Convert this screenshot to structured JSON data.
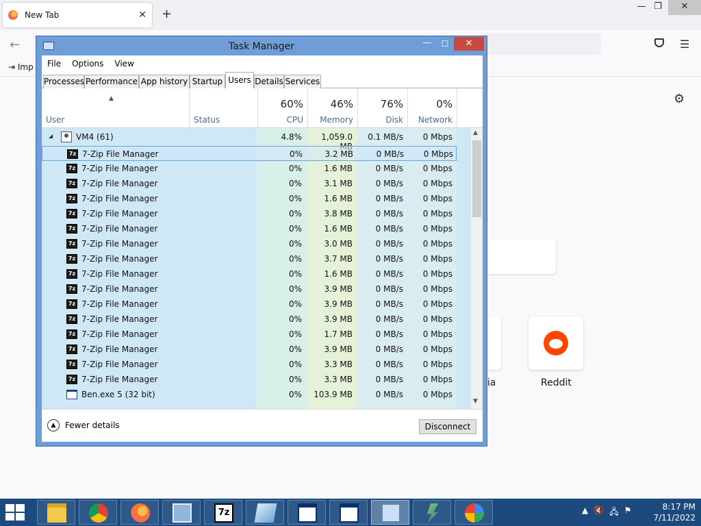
{
  "firefox": {
    "tab_title": "New Tab",
    "tab_close": "✕",
    "new_tab": "+",
    "import_label": "Imp",
    "partial_tile_label": "lia",
    "tile_label": "Reddit",
    "win_min": "—",
    "win_max": "❐",
    "win_close": "✕"
  },
  "task_manager": {
    "title": "Task Manager",
    "controls": {
      "minimize": "—",
      "maximize": "☐",
      "close": "✕"
    },
    "menu": [
      "File",
      "Options",
      "View"
    ],
    "tabs": [
      "Processes",
      "Performance",
      "App history",
      "Startup",
      "Users",
      "Details",
      "Services"
    ],
    "active_tab": "Users",
    "columns": {
      "user": "User",
      "status": "Status",
      "cpu": {
        "pct": "60%",
        "name": "CPU"
      },
      "memory": {
        "pct": "46%",
        "name": "Memory"
      },
      "disk": {
        "pct": "76%",
        "name": "Disk"
      },
      "network": {
        "pct": "0%",
        "name": "Network"
      }
    },
    "group": {
      "name": "VM4 (61)",
      "cpu": "4.8%",
      "memory": "1,059.0 MB",
      "disk": "0.1 MB/s",
      "network": "0 Mbps"
    },
    "rows": [
      {
        "name": "7-Zip File Manager",
        "icon": "7zip-icon",
        "cpu": "0%",
        "memory": "3.2 MB",
        "disk": "0 MB/s",
        "network": "0 Mbps"
      },
      {
        "name": "7-Zip File Manager",
        "icon": "7zip-icon",
        "cpu": "0%",
        "memory": "1.6 MB",
        "disk": "0 MB/s",
        "network": "0 Mbps"
      },
      {
        "name": "7-Zip File Manager",
        "icon": "7zip-icon",
        "cpu": "0%",
        "memory": "3.1 MB",
        "disk": "0 MB/s",
        "network": "0 Mbps"
      },
      {
        "name": "7-Zip File Manager",
        "icon": "7zip-icon",
        "cpu": "0%",
        "memory": "1.6 MB",
        "disk": "0 MB/s",
        "network": "0 Mbps"
      },
      {
        "name": "7-Zip File Manager",
        "icon": "7zip-icon",
        "cpu": "0%",
        "memory": "3.8 MB",
        "disk": "0 MB/s",
        "network": "0 Mbps"
      },
      {
        "name": "7-Zip File Manager",
        "icon": "7zip-icon",
        "cpu": "0%",
        "memory": "1.6 MB",
        "disk": "0 MB/s",
        "network": "0 Mbps"
      },
      {
        "name": "7-Zip File Manager",
        "icon": "7zip-icon",
        "cpu": "0%",
        "memory": "3.0 MB",
        "disk": "0 MB/s",
        "network": "0 Mbps"
      },
      {
        "name": "7-Zip File Manager",
        "icon": "7zip-icon",
        "cpu": "0%",
        "memory": "3.7 MB",
        "disk": "0 MB/s",
        "network": "0 Mbps"
      },
      {
        "name": "7-Zip File Manager",
        "icon": "7zip-icon",
        "cpu": "0%",
        "memory": "1.6 MB",
        "disk": "0 MB/s",
        "network": "0 Mbps"
      },
      {
        "name": "7-Zip File Manager",
        "icon": "7zip-icon",
        "cpu": "0%",
        "memory": "3.9 MB",
        "disk": "0 MB/s",
        "network": "0 Mbps"
      },
      {
        "name": "7-Zip File Manager",
        "icon": "7zip-icon",
        "cpu": "0%",
        "memory": "3.9 MB",
        "disk": "0 MB/s",
        "network": "0 Mbps"
      },
      {
        "name": "7-Zip File Manager",
        "icon": "7zip-icon",
        "cpu": "0%",
        "memory": "3.9 MB",
        "disk": "0 MB/s",
        "network": "0 Mbps"
      },
      {
        "name": "7-Zip File Manager",
        "icon": "7zip-icon",
        "cpu": "0%",
        "memory": "1.7 MB",
        "disk": "0 MB/s",
        "network": "0 Mbps"
      },
      {
        "name": "7-Zip File Manager",
        "icon": "7zip-icon",
        "cpu": "0%",
        "memory": "3.9 MB",
        "disk": "0 MB/s",
        "network": "0 Mbps"
      },
      {
        "name": "7-Zip File Manager",
        "icon": "7zip-icon",
        "cpu": "0%",
        "memory": "3.3 MB",
        "disk": "0 MB/s",
        "network": "0 Mbps"
      },
      {
        "name": "7-Zip File Manager",
        "icon": "7zip-icon",
        "cpu": "0%",
        "memory": "3.3 MB",
        "disk": "0 MB/s",
        "network": "0 Mbps"
      },
      {
        "name": "Ben.exe 5 (32 bit)",
        "icon": "window-icon",
        "cpu": "0%",
        "memory": "103.9 MB",
        "disk": "0 MB/s",
        "network": "0 Mbps"
      }
    ],
    "selected_row": 0,
    "footer": {
      "fewer_details": "Fewer details",
      "disconnect": "Disconnect"
    }
  },
  "taskbar": {
    "apps": [
      "file-explorer-icon",
      "chrome-icon",
      "firefox-icon",
      "control-panel-icon",
      "7zip-icon",
      "notepad-icon",
      "window-icon",
      "window-icon",
      "task-manager-icon",
      "power-shell-icon",
      "google-icon"
    ],
    "active_app": 8,
    "clock_time": "8:17 PM",
    "clock_date": "7/11/2022"
  },
  "colors": {
    "titlebar": "#6e9dd8",
    "close": "#c74a3f",
    "row_bg": "#cfe8f6",
    "heat_cpu": "#d9f0ea",
    "heat_mem": "#e6f2d8",
    "taskbar": "#1c4a7e"
  }
}
